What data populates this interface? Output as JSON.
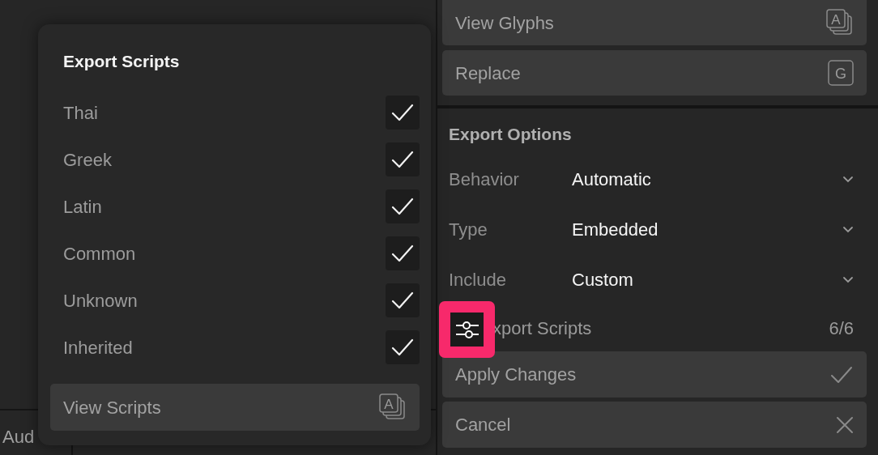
{
  "background_tab": {
    "label": "Aud"
  },
  "popup": {
    "title": "Export Scripts",
    "scripts": [
      {
        "label": "Thai",
        "checked": true
      },
      {
        "label": "Greek",
        "checked": true
      },
      {
        "label": "Latin",
        "checked": true
      },
      {
        "label": "Common",
        "checked": true
      },
      {
        "label": "Unknown",
        "checked": true
      },
      {
        "label": "Inherited",
        "checked": true
      }
    ],
    "button": {
      "label": "View Scripts",
      "icon_letter": "A"
    }
  },
  "panel": {
    "top_buttons": [
      {
        "label": "View Glyphs",
        "kind": "stack",
        "icon_letter": "A"
      },
      {
        "label": "Replace",
        "kind": "key",
        "icon_letter": "G"
      }
    ],
    "section_title": "Export Options",
    "fields": [
      {
        "label": "Behavior",
        "value": "Automatic"
      },
      {
        "label": "Type",
        "value": "Embedded"
      },
      {
        "label": "Include",
        "value": "Custom"
      }
    ],
    "scripts_row": {
      "label": "xport Scripts",
      "count": "6/6",
      "highlighted": true
    },
    "bottom_buttons": [
      {
        "label": "Apply Changes",
        "kind": "confirm"
      },
      {
        "label": "Cancel",
        "kind": "cancel"
      }
    ]
  }
}
